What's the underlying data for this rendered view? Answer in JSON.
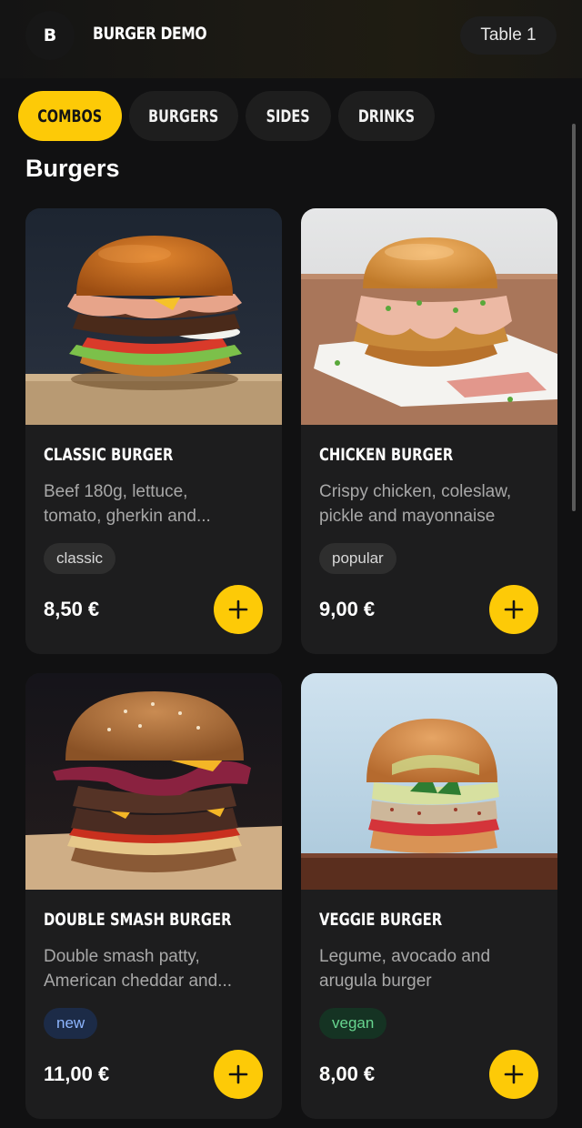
{
  "header": {
    "logo_letter": "B",
    "brand": "BURGER DEMO",
    "table": "Table 1"
  },
  "tabs": [
    {
      "label": "COMBOS",
      "active": true
    },
    {
      "label": "BURGERS",
      "active": false
    },
    {
      "label": "SIDES",
      "active": false
    },
    {
      "label": "DRINKS",
      "active": false
    }
  ],
  "section_title": "Burgers",
  "colors": {
    "accent": "#fdca07",
    "background": "#111112",
    "card": "#1d1d1e"
  },
  "products": [
    {
      "name": "CLASSIC BURGER",
      "desc_line1": "Beef 180g, lettuce,",
      "desc_line2": "tomato, gherkin and...",
      "badge": "classic",
      "price": "8,50 €",
      "icon": "plus-icon"
    },
    {
      "name": "CHICKEN BURGER",
      "desc_line1": "Crispy chicken, coleslaw,",
      "desc_line2": "pickle and mayonnaise",
      "badge": "popular",
      "price": "9,00 €",
      "icon": "plus-icon"
    },
    {
      "name": "DOUBLE SMASH BURGER",
      "desc_line1": "Double smash patty,",
      "desc_line2": "American cheddar and...",
      "badge": "new",
      "price": "11,00 €",
      "icon": "plus-icon"
    },
    {
      "name": "VEGGIE BURGER",
      "desc_line1": "Legume, avocado and",
      "desc_line2": "arugula burger",
      "badge": "vegan",
      "price": "8,00 €",
      "icon": "plus-icon"
    }
  ]
}
